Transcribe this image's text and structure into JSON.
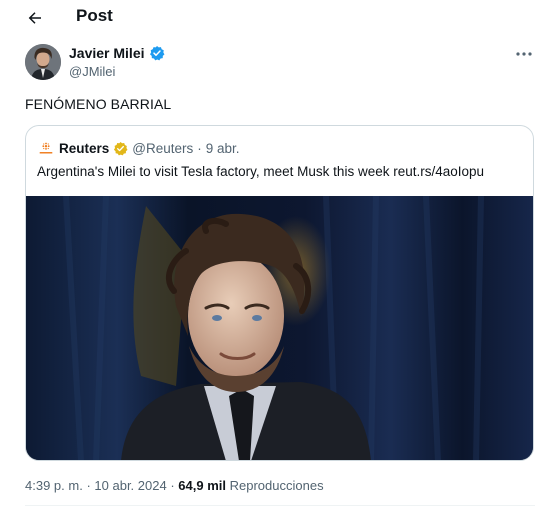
{
  "header": {
    "title": "Post"
  },
  "author": {
    "name": "Javier Milei",
    "handle": "@JMilei"
  },
  "tweet": {
    "text": "FENÓMENO BARRIAL"
  },
  "quote": {
    "name": "Reuters",
    "handle": "@Reuters",
    "separator": "·",
    "date": "9 abr.",
    "text": "Argentina's Milei to visit Tesla factory, meet Musk this week reut.rs/4aoIopu"
  },
  "meta": {
    "time": "4:39 p. m.",
    "separator": "·",
    "date": "10 abr. 2024",
    "views_count": "64,9 mil",
    "views_label": "Reproducciones"
  },
  "colors": {
    "verified_blue": "#1d9bf0",
    "verified_gold": "#e2b719",
    "secondary_text": "#536471"
  },
  "icons": [
    "back-arrow-icon",
    "verified-badge-icon",
    "more-icon",
    "reuters-logo-icon",
    "gold-verified-badge-icon"
  ]
}
